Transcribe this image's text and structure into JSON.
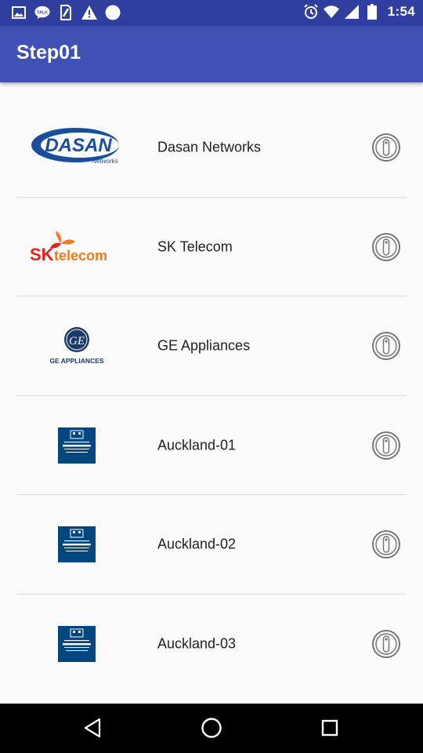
{
  "status_bar": {
    "time": "1:54",
    "left_icons": [
      "image-icon",
      "talk-icon",
      "sim-icon",
      "warning-icon",
      "circle-icon"
    ],
    "right_icons": [
      "alarm-icon",
      "wifi-icon",
      "signal-icon",
      "battery-icon"
    ],
    "talk_text": "TALK"
  },
  "app_bar": {
    "title": "Step01"
  },
  "items": [
    {
      "label": "Dasan Networks",
      "logo": "dasan-logo",
      "logo_text": "DASAN",
      "logo_sub": "Networks"
    },
    {
      "label": "SK Telecom",
      "logo": "sk-telecom-logo",
      "logo_text": "SK",
      "logo_sub": "telecom"
    },
    {
      "label": "GE Appliances",
      "logo": "ge-appliances-logo",
      "logo_text": "GE APPLIANCES"
    },
    {
      "label": "Auckland-01",
      "logo": "auckland-logo"
    },
    {
      "label": "Auckland-02",
      "logo": "auckland-logo"
    },
    {
      "label": "Auckland-03",
      "logo": "auckland-logo"
    }
  ],
  "nav_bar": {
    "buttons": [
      "back-icon",
      "home-icon",
      "recents-icon"
    ]
  },
  "colors": {
    "status_bar": "#303f9f",
    "app_bar": "#3f51b5",
    "background": "#fafafa"
  }
}
